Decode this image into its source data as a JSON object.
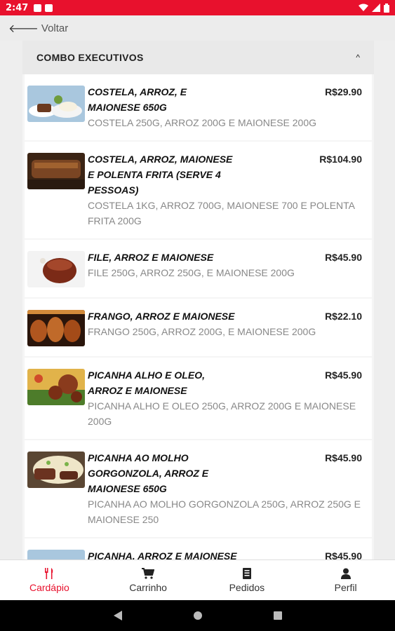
{
  "status_bar": {
    "time": "2:47"
  },
  "topbar": {
    "back_label": "Voltar"
  },
  "section": {
    "title": "COMBO EXECUTIVOS"
  },
  "items": [
    {
      "name": "COSTELA, ARROZ, E MAIONESE 650G",
      "price": "R$29.90",
      "desc": "COSTELA 250G, ARROZ 200G E MAIONESE 200G"
    },
    {
      "name": "COSTELA, ARROZ, MAIONESE E POLENTA FRITA (SERVE 4 PESSOAS)",
      "price": "R$104.90",
      "desc": "COSTELA 1KG, ARROZ 700G, MAIONESE 700 E POLENTA FRITA 200G"
    },
    {
      "name": "FILE, ARROZ E MAIONESE",
      "price": "R$45.90",
      "desc": "FILE 250G, ARROZ 250G, E MAIONESE 200G"
    },
    {
      "name": "FRANGO, ARROZ E MAIONESE",
      "price": "R$22.10",
      "desc": "FRANGO 250G, ARROZ 200G, E MAIONESE 200G"
    },
    {
      "name": "PICANHA ALHO E OLEO, ARROZ E MAIONESE",
      "price": "R$45.90",
      "desc": "PICANHA ALHO E OLEO 250G, ARROZ 200G E MAIONESE 200G"
    },
    {
      "name": "PICANHA AO MOLHO GORGONZOLA, ARROZ E MAIONESE 650G",
      "price": "R$45.90",
      "desc": "PICANHA AO MOLHO GORGONZOLA 250G, ARROZ 250G E MAIONESE 250"
    },
    {
      "name": "PICANHA, ARROZ E MAIONESE",
      "price": "R$45.90",
      "desc": ""
    }
  ],
  "bottom_nav": [
    {
      "label": "Cardápio",
      "icon": "utensils-icon",
      "active": true
    },
    {
      "label": "Carrinho",
      "icon": "cart-icon",
      "active": false
    },
    {
      "label": "Pedidos",
      "icon": "receipt-icon",
      "active": false
    },
    {
      "label": "Perfil",
      "icon": "person-icon",
      "active": false
    }
  ],
  "colors": {
    "accent": "#e8112d",
    "background": "#eeeeee"
  }
}
